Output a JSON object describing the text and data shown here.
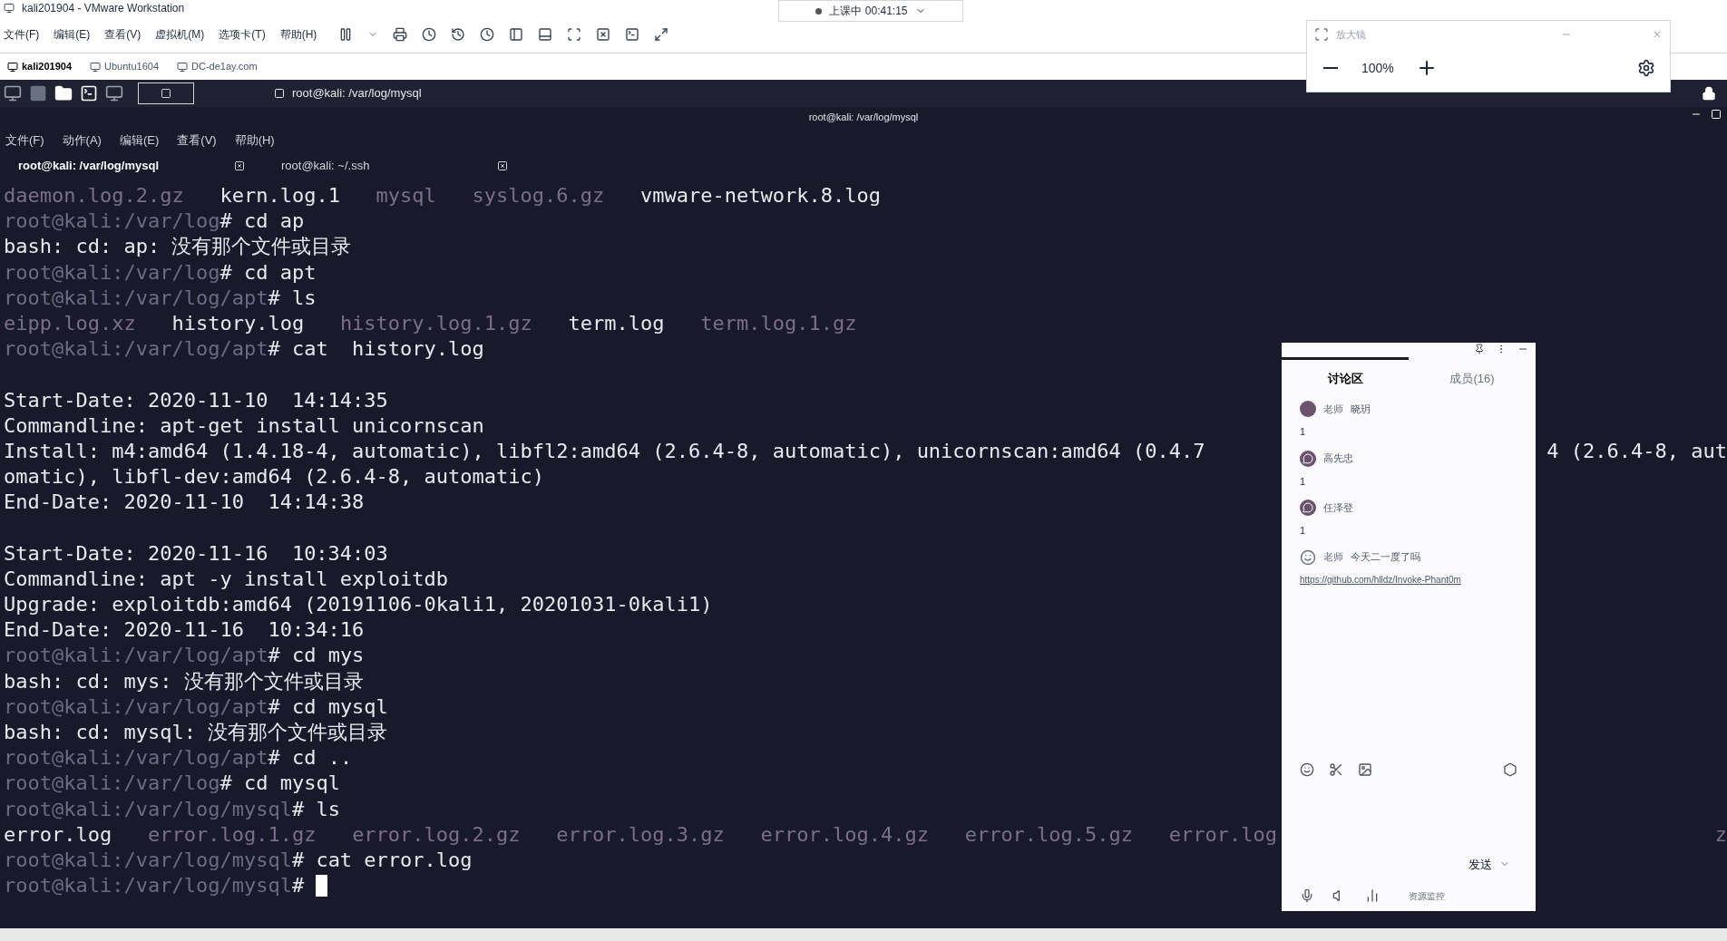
{
  "window": {
    "title": "kali201904 - VMware Workstation"
  },
  "recording": {
    "label": "上课中 00:41:15"
  },
  "menu": [
    "文件(F)",
    "编辑(E)",
    "查看(V)",
    "虚拟机(M)",
    "选项卡(T)",
    "帮助(H)"
  ],
  "vm_tabs": [
    {
      "label": "kali201904",
      "selected": true
    },
    {
      "label": "Ubuntu1604",
      "selected": false
    },
    {
      "label": "DC-de1ay.com",
      "selected": false
    }
  ],
  "taskbar": {
    "task": "root@kali: /var/log/mysql"
  },
  "terminal": {
    "title": "root@kali: /var/log/mysql",
    "menu": [
      "文件(F)",
      "动作(A)",
      "编辑(E)",
      "查看(V)",
      "帮助(H)"
    ],
    "tabs": [
      {
        "label": "root@kali: /var/log/mysql",
        "selected": true
      },
      {
        "label": "root@kali: ~/.ssh",
        "selected": false
      }
    ],
    "lines": [
      {
        "kind": "listing",
        "items": [
          {
            "kind": "dim",
            "text": "daemon.log.2.gz"
          },
          {
            "kind": "plain",
            "text": "kern.log.1"
          },
          {
            "kind": "dim",
            "text": "mysql"
          },
          {
            "kind": "dim",
            "text": "syslog.6.gz"
          },
          {
            "kind": "plain",
            "text": "vmware-network.8.log"
          }
        ]
      },
      {
        "segments": [
          {
            "kind": "prompt",
            "text": "root@kali:/var/log"
          },
          {
            "kind": "plain",
            "text": "# cd ap"
          }
        ]
      },
      {
        "segments": [
          {
            "kind": "plain",
            "text": "bash: cd: ap: 没有那个文件或目录"
          }
        ]
      },
      {
        "segments": [
          {
            "kind": "prompt",
            "text": "root@kali:/var/log"
          },
          {
            "kind": "plain",
            "text": "# cd apt"
          }
        ]
      },
      {
        "segments": [
          {
            "kind": "prompt",
            "text": "root@kali:/var/log/apt"
          },
          {
            "kind": "plain",
            "text": "# ls"
          }
        ]
      },
      {
        "kind": "listing",
        "items": [
          {
            "kind": "dim",
            "text": "eipp.log.xz"
          },
          {
            "kind": "plain",
            "text": "history.log"
          },
          {
            "kind": "dim",
            "text": "history.log.1.gz"
          },
          {
            "kind": "plain",
            "text": "term.log"
          },
          {
            "kind": "dim",
            "text": "term.log.1.gz"
          }
        ]
      },
      {
        "segments": [
          {
            "kind": "prompt",
            "text": "root@kali:/var/log/apt"
          },
          {
            "kind": "plain",
            "text": "# cat  history.log"
          }
        ]
      },
      {
        "kind": "blank"
      },
      {
        "segments": [
          {
            "kind": "plain",
            "text": "Start-Date: 2020-11-10  14:14:35"
          }
        ]
      },
      {
        "segments": [
          {
            "kind": "plain",
            "text": "Commandline: apt-get install unicornscan"
          }
        ]
      },
      {
        "segments": [
          {
            "kind": "plain",
            "text": "Install: m4:amd64 (1.4.18-4, automatic), libfl2:amd64 (2.6.4-8, automatic), unicornscan:amd64 (0.4.7"
          }
        ],
        "right": {
          "kind": "plain",
          "text": "4 (2.6.4-8, aut"
        }
      },
      {
        "segments": [
          {
            "kind": "plain",
            "text": "omatic), libfl-dev:amd64 (2.6.4-8, automatic)"
          }
        ]
      },
      {
        "segments": [
          {
            "kind": "plain",
            "text": "End-Date: 2020-11-10  14:14:38"
          }
        ]
      },
      {
        "kind": "blank"
      },
      {
        "segments": [
          {
            "kind": "plain",
            "text": "Start-Date: 2020-11-16  10:34:03"
          }
        ]
      },
      {
        "segments": [
          {
            "kind": "plain",
            "text": "Commandline: apt -y install exploitdb"
          }
        ]
      },
      {
        "segments": [
          {
            "kind": "plain",
            "text": "Upgrade: exploitdb:amd64 (20191106-0kali1, 20201031-0kali1)"
          }
        ]
      },
      {
        "segments": [
          {
            "kind": "plain",
            "text": "End-Date: 2020-11-16  10:34:16"
          }
        ]
      },
      {
        "segments": [
          {
            "kind": "prompt",
            "text": "root@kali:/var/log/apt"
          },
          {
            "kind": "plain",
            "text": "# cd mys"
          }
        ]
      },
      {
        "segments": [
          {
            "kind": "plain",
            "text": "bash: cd: mys: 没有那个文件或目录"
          }
        ]
      },
      {
        "segments": [
          {
            "kind": "prompt",
            "text": "root@kali:/var/log/apt"
          },
          {
            "kind": "plain",
            "text": "# cd mysql"
          }
        ]
      },
      {
        "segments": [
          {
            "kind": "plain",
            "text": "bash: cd: mysql: 没有那个文件或目录"
          }
        ]
      },
      {
        "segments": [
          {
            "kind": "prompt",
            "text": "root@kali:/var/log/apt"
          },
          {
            "kind": "plain",
            "text": "# cd .."
          }
        ]
      },
      {
        "segments": [
          {
            "kind": "prompt",
            "text": "root@kali:/var/log"
          },
          {
            "kind": "plain",
            "text": "# cd mysql"
          }
        ]
      },
      {
        "segments": [
          {
            "kind": "prompt",
            "text": "root@kali:/var/log/mysql"
          },
          {
            "kind": "plain",
            "text": "# ls"
          }
        ]
      },
      {
        "kind": "listing",
        "items": [
          {
            "kind": "plain",
            "text": "error.log"
          },
          {
            "kind": "dim",
            "text": "error.log.1.gz"
          },
          {
            "kind": "dim",
            "text": "error.log.2.gz"
          },
          {
            "kind": "dim",
            "text": "error.log.3.gz"
          },
          {
            "kind": "dim",
            "text": "error.log.4.gz"
          },
          {
            "kind": "dim",
            "text": "error.log.5.gz"
          },
          {
            "kind": "dim",
            "text": "error.log"
          }
        ],
        "right": {
          "kind": "dim",
          "text": "z"
        }
      },
      {
        "segments": [
          {
            "kind": "prompt",
            "text": "root@kali:/var/log/mysql"
          },
          {
            "kind": "plain",
            "text": "# cat error.log"
          }
        ]
      },
      {
        "segments": [
          {
            "kind": "prompt",
            "text": "root@kali:/var/log/mysql"
          },
          {
            "kind": "plain",
            "text": "#"
          }
        ],
        "cursor": true
      }
    ]
  },
  "chat": {
    "tabs": [
      {
        "label": "讨论区",
        "selected": true
      },
      {
        "label": "成员(16)",
        "selected": false
      }
    ],
    "messages": [
      {
        "kind": "dot",
        "role": "老师",
        "name": "晓玥",
        "text": "1"
      },
      {
        "kind": "wechat",
        "name": "高先忠",
        "text": "1"
      },
      {
        "kind": "wechat",
        "name": "任泽登",
        "text": "1"
      },
      {
        "kind": "doodle",
        "role": "老师",
        "name": "今天二一度了吗",
        "link": "https://github.com/hlldz/Invoke-Phant0m"
      }
    ],
    "send": "发送",
    "footer": "资源监控"
  },
  "magnifier": {
    "title": "放大镜",
    "zoom": "100%"
  }
}
